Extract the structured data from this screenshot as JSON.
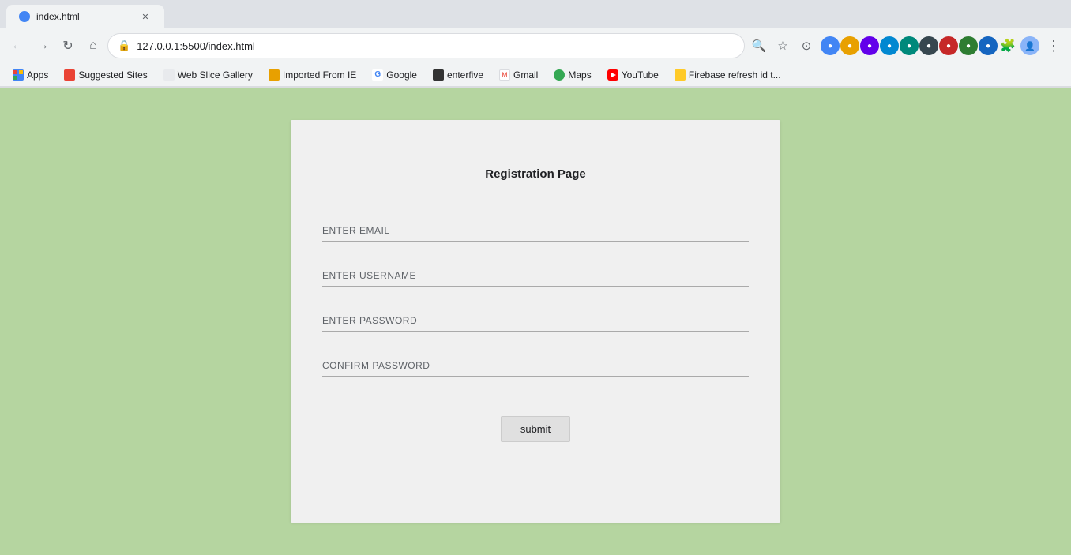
{
  "browser": {
    "tab": {
      "title": "index.html",
      "url": "127.0.0.1:5500/index.html"
    },
    "nav": {
      "back_title": "Back",
      "forward_title": "Forward",
      "reload_title": "Reload",
      "home_title": "Home"
    },
    "bookmarks": [
      {
        "id": "apps",
        "label": "Apps",
        "favicon_type": "apps"
      },
      {
        "id": "suggested-sites",
        "label": "Suggested Sites",
        "favicon_type": "red"
      },
      {
        "id": "web-slice-gallery",
        "label": "Web Slice Gallery",
        "favicon_type": "blue-circle"
      },
      {
        "id": "imported-from-ie",
        "label": "Imported From IE",
        "favicon_type": "orange"
      },
      {
        "id": "google",
        "label": "Google",
        "favicon_type": "g"
      },
      {
        "id": "enterfive",
        "label": "enterfive",
        "favicon_type": "enterfive"
      },
      {
        "id": "gmail",
        "label": "Gmail",
        "favicon_type": "gmail"
      },
      {
        "id": "maps",
        "label": "Maps",
        "favicon_type": "maps"
      },
      {
        "id": "youtube",
        "label": "YouTube",
        "favicon_type": "yt"
      },
      {
        "id": "firebase",
        "label": "Firebase refresh id t...",
        "favicon_type": "firebase"
      }
    ]
  },
  "page": {
    "title": "Registration Page",
    "form": {
      "email_placeholder": "ENTER EMAIL",
      "username_placeholder": "ENTER USERNAME",
      "password_placeholder": "ENTER PASSWORD",
      "confirm_password_placeholder": "CONFIRM PASSWORD",
      "submit_label": "submit"
    }
  }
}
